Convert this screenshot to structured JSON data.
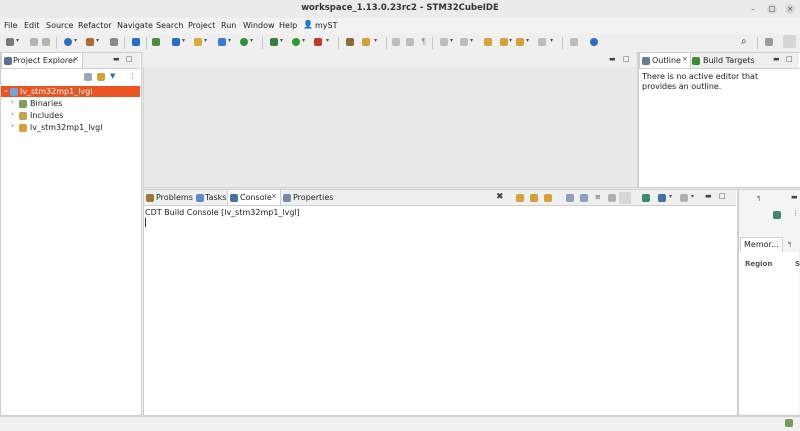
{
  "window": {
    "title": "workspace_1.13.0.23rc2 - STM32CubeIDE",
    "minimize": "–",
    "maximize": "□",
    "close": "×"
  },
  "menu": [
    "File",
    "Edit",
    "Source",
    "Refactor",
    "Navigate",
    "Search",
    "Project",
    "Run",
    "Window",
    "Help"
  ],
  "account": "myST",
  "project_explorer": {
    "tab_label": "Project Explorer",
    "close": "×",
    "tree": [
      {
        "label": "lv_stm32mp1_lvgl",
        "selected": true
      },
      {
        "label": "Binaries"
      },
      {
        "label": "Includes"
      },
      {
        "label": "lv_stm32mp1_lvgl"
      }
    ]
  },
  "outline": {
    "tab_label": "Outline",
    "close": "×",
    "build_targets_label": "Build Targets",
    "message": "There is no active editor that provides an outline."
  },
  "bottom": {
    "tabs": [
      "Problems",
      "Tasks",
      "Console",
      "Properties"
    ],
    "console_close": "×",
    "console_title": "CDT Build Console [lv_stm32mp1_lvgl]"
  },
  "memory": {
    "tab_label": "Memor...",
    "column_region": "Region",
    "column_s": "S"
  },
  "colors": {
    "selection": "#e95420",
    "accent_blue": "#2a6fc2"
  }
}
